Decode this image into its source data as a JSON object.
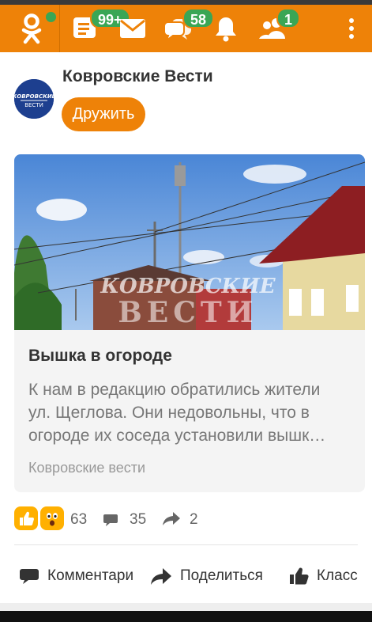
{
  "colors": {
    "brand": "#ee8208",
    "badge": "#3aa655"
  },
  "appbar": {
    "logo_icon": "odnoklassniki-logo",
    "items": [
      {
        "icon": "feed-icon",
        "badge": "99+"
      },
      {
        "icon": "mail-icon"
      },
      {
        "icon": "messages-icon",
        "badge": "58"
      },
      {
        "icon": "bell-icon"
      },
      {
        "icon": "friends-icon",
        "badge": "1"
      },
      {
        "icon": "more-vertical-icon"
      }
    ]
  },
  "post": {
    "author": "Ковровские Вести",
    "avatar_text": [
      "КОВРОВСКИЕ",
      "ВЕСТИ"
    ],
    "friend_button": "Дружить",
    "card": {
      "title": "Вышка в огороде",
      "text_lines": [
        "К нам в редакцию обратились жители",
        "ул. Щеглова. Они недовольны, что в",
        "огороде их соседа установили вышк…"
      ],
      "source": "Ковровские вести",
      "watermark": [
        "КОВРОВСКИЕ",
        "ВЕСТИ"
      ]
    },
    "stats": {
      "reactions": 63,
      "comments": 35,
      "shares": 2
    },
    "actions": {
      "comments": "Комментари",
      "share": "Поделиться",
      "like": "Класс"
    }
  }
}
